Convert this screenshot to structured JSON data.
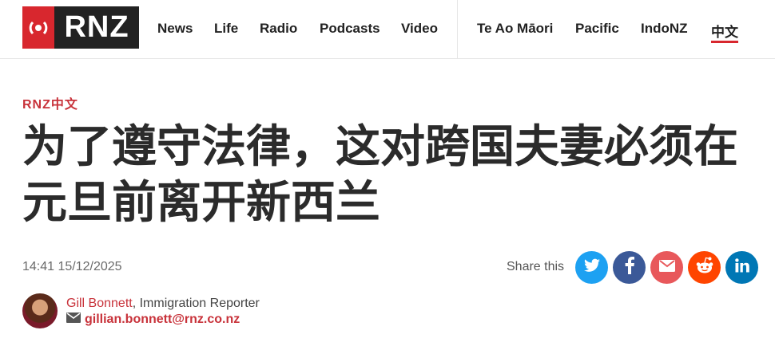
{
  "brand": {
    "logo_text": "RNZ"
  },
  "nav": {
    "primary": [
      {
        "label": "News"
      },
      {
        "label": "Life"
      },
      {
        "label": "Radio"
      },
      {
        "label": "Podcasts"
      },
      {
        "label": "Video"
      }
    ],
    "secondary": [
      {
        "label": "Te Ao Māori"
      },
      {
        "label": "Pacific"
      },
      {
        "label": "IndoNZ"
      },
      {
        "label": "中文",
        "active": true
      }
    ]
  },
  "article": {
    "kicker": "RNZ中文",
    "headline": "为了遵守法律，这对跨国夫妻必须在元旦前离开新西兰",
    "timestamp": "14:41 15/12/2025"
  },
  "share": {
    "label": "Share this",
    "buttons": [
      {
        "icon": "twitter-icon",
        "color": "#1da1f2"
      },
      {
        "icon": "facebook-icon",
        "color": "#3b5998"
      },
      {
        "icon": "email-icon",
        "color": "#e8585b"
      },
      {
        "icon": "reddit-icon",
        "color": "#ff4500"
      },
      {
        "icon": "linkedin-icon",
        "color": "#0077b5"
      }
    ]
  },
  "author": {
    "name": "Gill Bonnett",
    "role": ", Immigration Reporter",
    "email": "gillian.bonnett@rnz.co.nz"
  },
  "colors": {
    "accent": "#d8272e",
    "link": "#c8323a"
  }
}
